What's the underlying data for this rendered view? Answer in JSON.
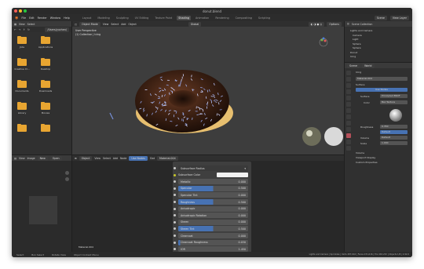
{
  "window": {
    "title": "donut.blend"
  },
  "menu": {
    "items": [
      "File",
      "Edit",
      "Render",
      "Window",
      "Help"
    ]
  },
  "workspaces": {
    "items": [
      "Layout",
      "Modeling",
      "Sculpting",
      "UV Editing",
      "Texture Paint",
      "Shading",
      "Animation",
      "Rendering",
      "Compositing",
      "Scripting"
    ],
    "active": "Shading"
  },
  "top_right": {
    "scene": "Scene",
    "view_layer": "View Layer"
  },
  "file_browser": {
    "header": {
      "view": "View",
      "select": "Select"
    },
    "path": "/Users/yuchen/",
    "folders": [
      "Jobs",
      "Applications",
      "Creative Cl...",
      "Desktop",
      "Documents",
      "Downloads",
      "Library",
      "Movies",
      "",
      ""
    ]
  },
  "viewport": {
    "header": {
      "mode": "Object Mode",
      "view": "View",
      "select": "Select",
      "add": "Add",
      "object": "Object",
      "transform": "Global"
    },
    "info": [
      "User Perspective",
      "(1) Collection | Icing"
    ],
    "options": "Options"
  },
  "image_editor": {
    "view": "View",
    "image": "Image",
    "new": "New",
    "open": "Open"
  },
  "node_editor": {
    "header": {
      "object": "Object",
      "view": "View",
      "select": "Select",
      "add": "Add",
      "node": "Node",
      "use_nodes": "Use Nodes",
      "slot": "Slot",
      "material": "Material.004"
    },
    "material_label": "Material.004",
    "rows": [
      {
        "label": "Subsurface Radius",
        "value": "",
        "kind": "dropdown"
      },
      {
        "label": "Subsurface Color",
        "value": "",
        "kind": "color"
      },
      {
        "label": "Metallic",
        "value": "0.000",
        "fill": 0
      },
      {
        "label": "Specular",
        "value": "0.500",
        "fill": 0.5
      },
      {
        "label": "Specular Tint",
        "value": "0.000",
        "fill": 0
      },
      {
        "label": "Roughness",
        "value": "0.500",
        "fill": 0.5
      },
      {
        "label": "Anisotropic",
        "value": "0.000",
        "fill": 0
      },
      {
        "label": "Anisotropic Rotation",
        "value": "0.000",
        "fill": 0
      },
      {
        "label": "Sheen",
        "value": "0.000",
        "fill": 0
      },
      {
        "label": "Sheen Tint",
        "value": "0.500",
        "fill": 0.5
      },
      {
        "label": "Clearcoat",
        "value": "0.000",
        "fill": 0
      },
      {
        "label": "Clearcoat Roughness",
        "value": "0.030",
        "fill": 0.03
      },
      {
        "label": "IOR",
        "value": "1.450",
        "fill": 0
      }
    ]
  },
  "outliner": {
    "header": "Scene Collection",
    "items": [
      "Lights and Camera",
      "Camera",
      "Light",
      "Sphere",
      "Sphere",
      "Donut",
      "Icing"
    ]
  },
  "properties": {
    "tabs": [
      "Scene",
      "World"
    ],
    "object": "Icing",
    "material": "Material.004",
    "surface_header": "Surface",
    "use_nodes": "Use Nodes",
    "surface_label": "Surface",
    "surface_value": "Principled BSDF",
    "color_label": "Color",
    "color_value": "Bsz Texture",
    "roughness_label": "Roughness",
    "roughness_value": "0.350",
    "default_label": "Default",
    "volume": "Volume",
    "displacement_label": "Displacement",
    "displacement_value": "Default",
    "scale_label": "Scale",
    "scale_value": "1.000",
    "sections": [
      "Volume",
      "Viewport Display",
      "Custom Properties"
    ]
  },
  "status": {
    "items": [
      "Select",
      "Box Select",
      "Rotate View",
      "Object Context Menu"
    ],
    "right": "Lights and Camera | Sprinkles | Verts 487,616 | Faces 231,616 | Tris 463,232 | Objects 1/8 | 2.92.0"
  },
  "colors": {
    "accent": "#4772b3",
    "folder": "#e8a531",
    "icing": "#3a1f12",
    "dough": "#e7bf6f"
  }
}
